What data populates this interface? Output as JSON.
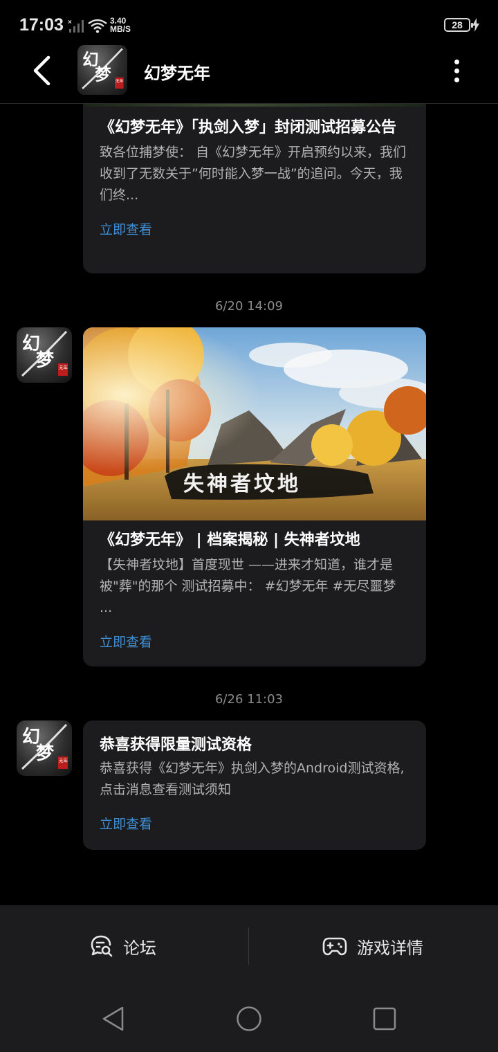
{
  "status_bar": {
    "time": "17:03",
    "net_speed_value": "3.40",
    "net_speed_unit": "MB/S",
    "battery": "28"
  },
  "header": {
    "title": "幻梦无年",
    "logo_text_1": "幻",
    "logo_text_2": "梦",
    "logo_seal": "无年"
  },
  "messages": [
    {
      "title": "《幻梦无年》「执剑入梦」封闭测试招募公告",
      "desc": "致各位捕梦使：  自《幻梦无年》开启预约以来，我们收到了无数关于”何时能入梦一战”的追问。今天，我们终...",
      "link": "立即查看"
    },
    {
      "timestamp": "6/20  14:09",
      "banner_caption": "失神者坟地",
      "title": "《幻梦无年》 | 档案揭秘 | 失神者坟地",
      "desc": "【失神者坟地】首度现世 ——进来才知道，谁才是被\"葬\"的那个 测试招募中： #幻梦无年 #无尽噩梦 ...",
      "link": "立即查看"
    },
    {
      "timestamp": "6/26  11:03",
      "title": "恭喜获得限量测试资格",
      "desc": "恭喜获得《幻梦无年》执剑入梦的Android测试资格,点击消息查看测试须知",
      "link": "立即查看"
    }
  ],
  "bottom_bar": {
    "forum_label": "论坛",
    "game_detail_label": "游戏详情"
  },
  "icons": {
    "back": "back-arrow-icon",
    "more": "more-vertical-icon",
    "forum": "chat-search-icon",
    "game": "gamepad-icon",
    "nav_back": "nav-back-icon",
    "nav_home": "nav-home-icon",
    "nav_recent": "nav-recent-icon"
  },
  "colors": {
    "background": "#000000",
    "card": "#1c1c1e",
    "link": "#3f8fd6",
    "text_secondary": "#b2b2b2",
    "timestamp": "#8c8c8c"
  }
}
